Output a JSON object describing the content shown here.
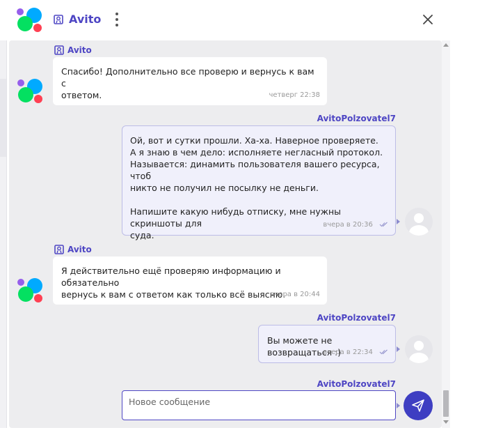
{
  "header": {
    "title": "Avito",
    "menu_icon": "kebab-menu-icon",
    "close_icon": "close-icon",
    "verified_icon": "verified-badge-icon",
    "logo_colors": [
      "#965eeb",
      "#00aaff",
      "#04e061",
      "#ff4053"
    ]
  },
  "messages": [
    {
      "sender": "Avito",
      "direction": "incoming",
      "text": "Спасибо! Дополнительно все проверю и вернусь к вам с\nответом.",
      "time": "четверг 22:38"
    },
    {
      "sender": "AvitoPolzovatel7",
      "direction": "outgoing",
      "text": "Ой, вот и сутки прошли. Ха-ха. Наверное проверяете.\nА я знаю в чем дело: исполняете негласный протокол.\nНазывается: динамить пользователя вашего ресурса, чтоб\nникто не получил не посылку не деньги.\n\nНапишите какую нибудь отписку, мне нужны скриншоты для\nсуда.",
      "time": "вчера в 20:36"
    },
    {
      "sender": "Avito",
      "direction": "incoming",
      "text": "Я действительно ещё проверяю информацию и обязательно\nвернусь к вам с ответом как только всё выясню.",
      "time": "вчера в 20:44"
    },
    {
      "sender": "AvitoPolzovatel7",
      "direction": "outgoing",
      "text": "Вы можете не возвращаться :)",
      "time": "вчера в 22:34"
    }
  ],
  "composer": {
    "sender": "AvitoPolzovatel7",
    "placeholder": "Новое сообщение",
    "value": "",
    "send_icon": "send-icon"
  },
  "colors": {
    "accent": "#4e46c4",
    "send_button": "#3e3ec2",
    "chat_background": "#ededef",
    "outgoing_bubble": "#f0f0fb",
    "incoming_bubble": "#ffffff"
  }
}
